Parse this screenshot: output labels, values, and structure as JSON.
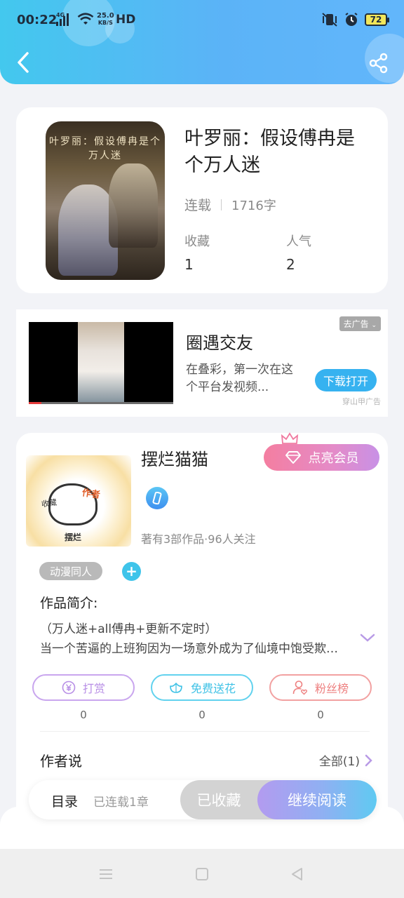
{
  "status_bar": {
    "time": "00:22",
    "network": "4G",
    "speed_value": "25.0",
    "speed_unit": "KB/S",
    "hd": "HD",
    "battery": "72"
  },
  "header": {
    "back_icon": "chevron-left-icon",
    "share_icon": "share-icon"
  },
  "book": {
    "cover_text": "叶罗丽：假设傅冉是个万人迷",
    "title": "叶罗丽：假设傅冉是个万人迷",
    "status": "连载",
    "word_count": "1716字",
    "favorites_label": "收藏",
    "favorites_value": "1",
    "popularity_label": "人气",
    "popularity_value": "2"
  },
  "ad": {
    "title": "圈遇交友",
    "description": "在叠彩，第一次在这个平台发视频...",
    "remove_label": "去广告",
    "download_button": "下载打开",
    "source": "穿山甲广告"
  },
  "author": {
    "name": "摆烂猫猫",
    "vip_button": "点亮会员",
    "stats": "著有3部作品·96人关注",
    "avatar_tags": [
      "收藏",
      "作者",
      "摆烂"
    ],
    "genre_tag": "动漫同人",
    "intro_label": "作品简介:",
    "intro_line1": "（万人迷+all傅冉+更新不定时）",
    "intro_line2": "当一个苦逼的上班狗因为一场意外成为了仙境中饱受欺凌的...",
    "actions": [
      {
        "label": "打赏",
        "count": "0",
        "color": "#c39ae8",
        "icon": "yen-coin-icon"
      },
      {
        "label": "免费送花",
        "count": "0",
        "color": "#5cd0ec",
        "icon": "flower-icon"
      },
      {
        "label": "粉丝榜",
        "count": "0",
        "color": "#f08b8b",
        "icon": "fan-user-icon"
      }
    ],
    "author_says": "作者说",
    "all_link": "全部(1)"
  },
  "bottom_bar": {
    "toc_label": "目录",
    "toc_sub": "已连载1章",
    "collected_button": "已收藏",
    "read_button": "继续阅读"
  },
  "colors": {
    "header_start": "#43c8ee",
    "header_end": "#62b6fb",
    "accent_blue": "#36b2f0",
    "vip_pink": "#f47ea0"
  }
}
